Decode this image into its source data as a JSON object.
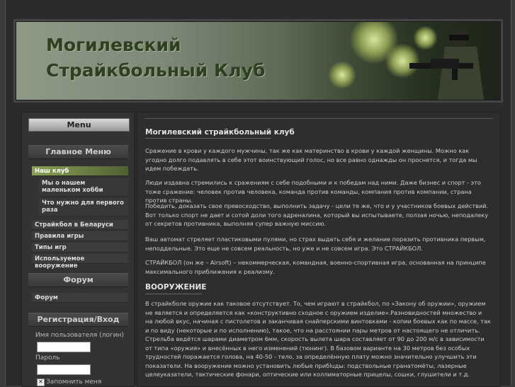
{
  "header": {
    "title_line1": "Могилевский",
    "title_line2": "Страйкбольный Клуб"
  },
  "sidebar": {
    "menu_label": "Menu",
    "main_menu_heading": "Главное Меню",
    "items": [
      {
        "label": "Наш клуб",
        "active": true
      },
      {
        "label": "Мы о нашем маленьком хобби",
        "sub": true
      },
      {
        "label": "Что нужно для первого раза",
        "sub": true
      },
      {
        "label": "Страйкбол в Беларуси"
      },
      {
        "label": "Правила игры"
      },
      {
        "label": "Типы игр"
      },
      {
        "label": "Используемое вооружение"
      }
    ],
    "forum_heading": "Форум",
    "forum_link": "Форум",
    "login_heading": "Регистрация/Вход",
    "username_label": "Имя пользователя (логин)",
    "password_label": "Пароль",
    "remember_label": "Запомнить меня"
  },
  "main": {
    "article_title": "Могилевский страйкбольный клуб",
    "paragraphs": [
      "Сражение в крови у каждого мужчины, так же как материнство в крови у каждой женщины. Можно как угодно долго подавлять в себе этот воинствующий голос, но все равно однажды он проснется, и тогда мы идем побеждать.",
      "Люди издавна стремились к сражениям с себе подобными и к победам над ними. Даже бизнес и спорт - это тоже сражение: человек против человека, команда против команды, компания против компании, страна против страны.",
      "Победить, доказать свое превосходство, выполнить задачу - цели те же, что и у участников боевых действий. Вот только спорт не дает и сотой доли того адреналина, который вы испытываете, ползая ночью, неподалеку от секретов противника, выполняя супер важную миссию.",
      "Ваш автомат стреляет пластиковыми пулями, но страх выдать себя и желание поразить противника первым, неподдельные. Это еще не совсем реальность, но уже и не совсем игра. Это СТРАЙКБОЛ.",
      "СТРАЙКБОЛ (он же – Airsoft) – некоммерческая, командная, военно-спортивная игра, основанная на принципе максимального приближения к реализму."
    ],
    "section_title": "ВООРУЖЕНИЕ",
    "section_paragraph": "В страйкболе оружие как таковое отсутствует. То, чем играют в страйкбол, по «Закону об оружии», оружием не является и определяется как «конструктивно сходное с оружием изделие».Разновидностей множество и на любой вкус, начиная с пистолетов и заканчивая снайперскими винтовками - копии боевых как по массе, так и по виду (некоторые и по исполнению), такое, что на расстоянии пары метров от настоящего не отличить. Стрельба ведётся шарами диаметром 6мм, скорость вылета шара составляет от 90 до 200 м/с в зависимости от типа «оружия» и внесённых в него изменений (тюнинг). В базовом варианте на 30 метров без особых трудностей поражается голова, на 40-50 - тело, за определённую плату можно значительно улучшить эти показатели. На вооружение можно установить любые прибluды: подствольные гранатомёты, лазерные целеуказатели, тактические фонари, оптические или коллиматорные прицелы, сошки, глушители и т.д."
  }
}
